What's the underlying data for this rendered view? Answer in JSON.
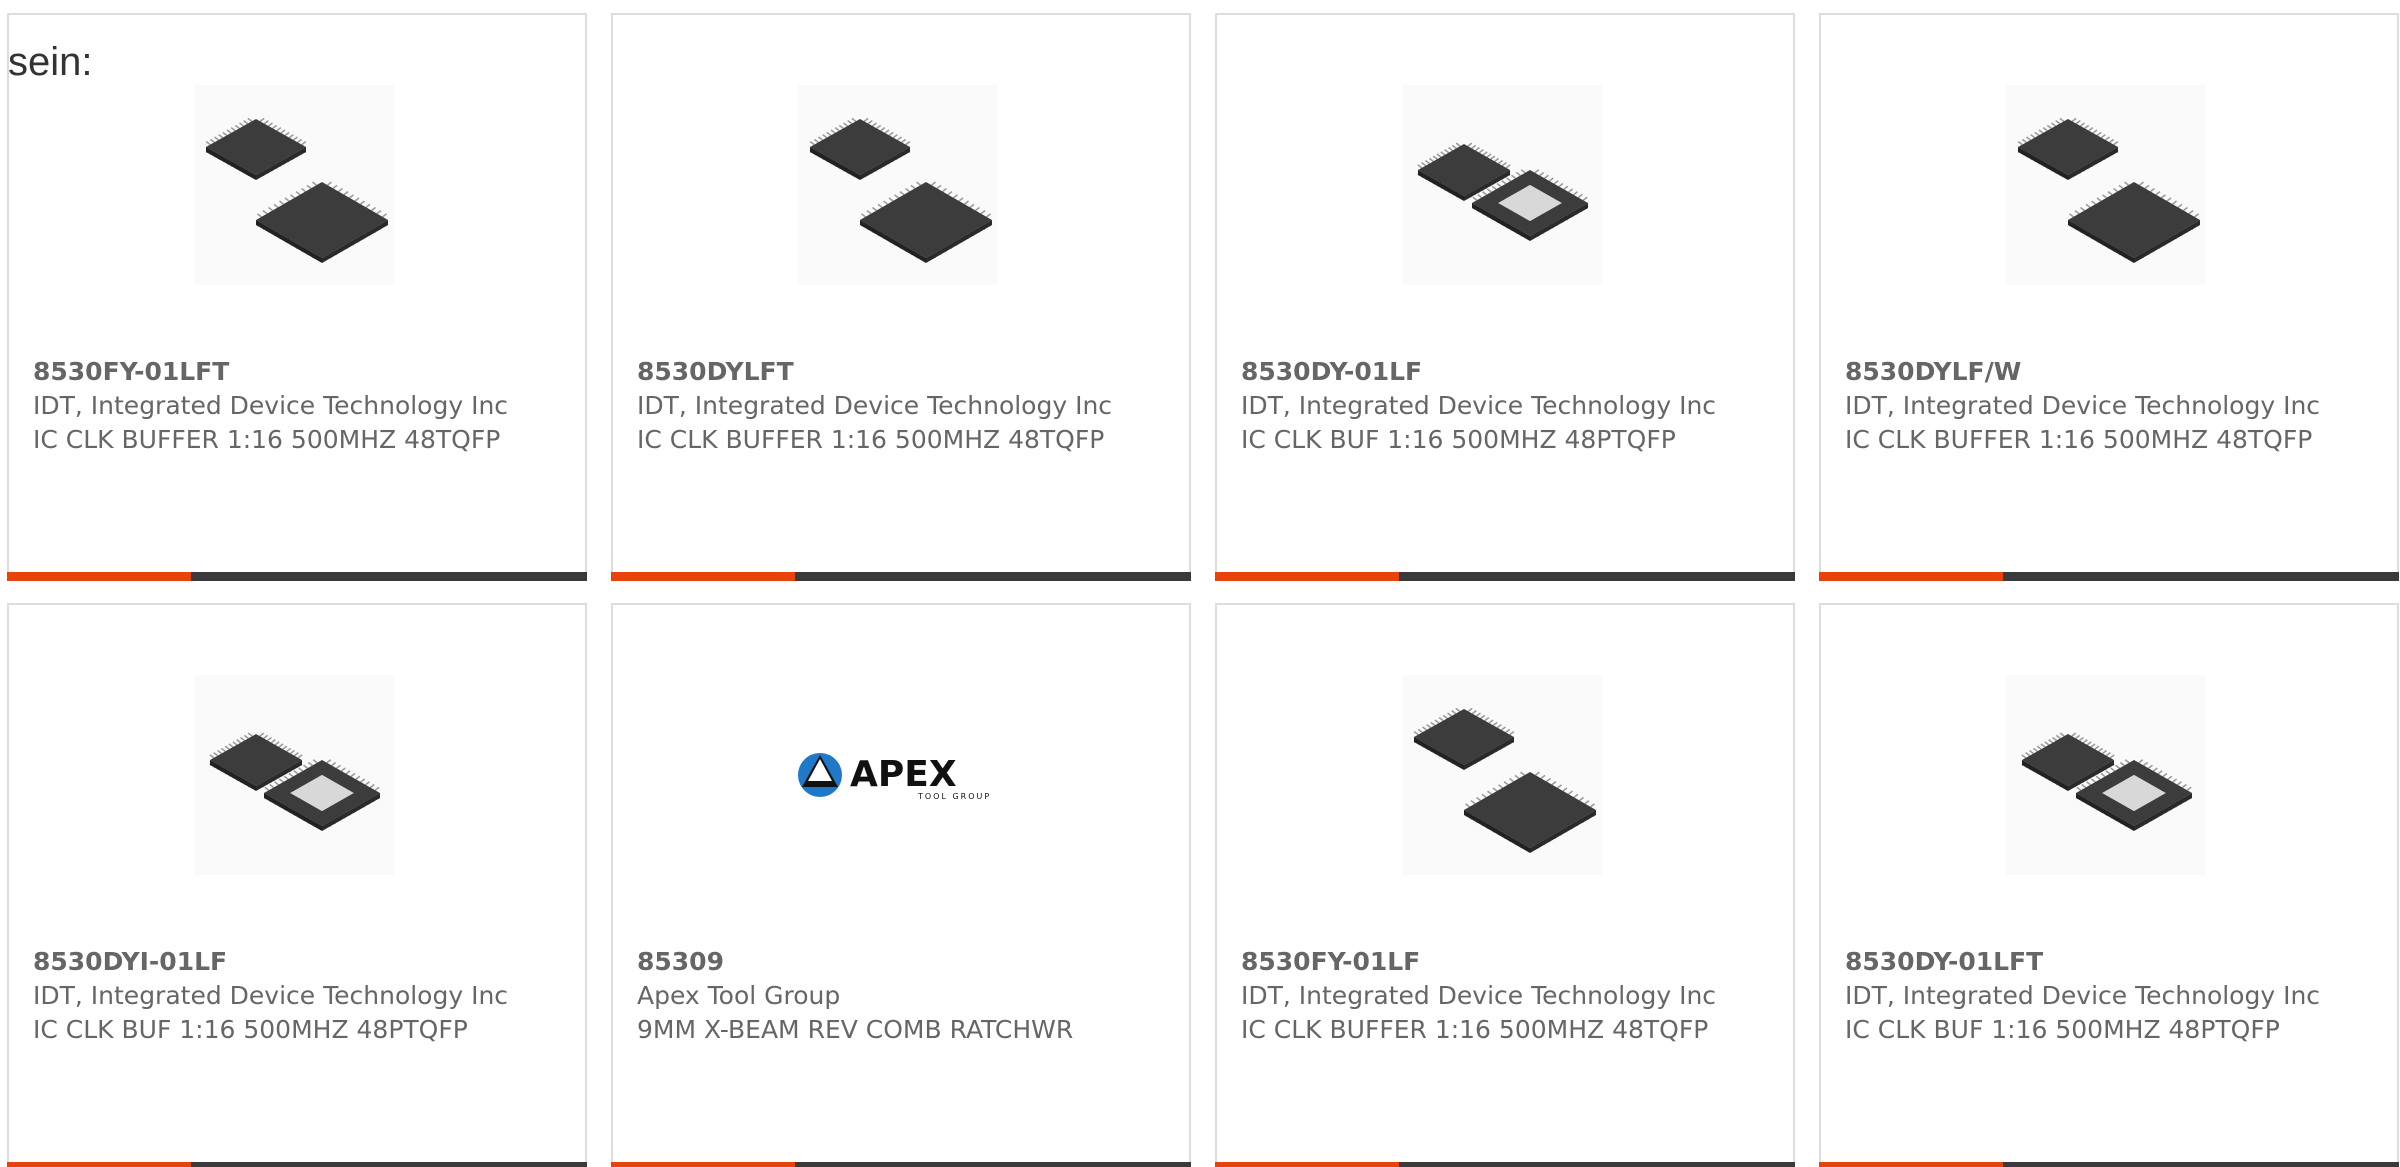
{
  "stray_text": "sein:",
  "colors": {
    "accent": "#e8430c",
    "bar": "#3a3a3a",
    "border": "#dddddd",
    "text": "#666666"
  },
  "products": [
    {
      "part": "8530FY-01LFT",
      "manufacturer": "IDT, Integrated Device Technology Inc",
      "description": "IC CLK BUFFER 1:16 500MHZ 48TQFP",
      "image": "chip-pair-dark"
    },
    {
      "part": "8530DYLFT",
      "manufacturer": "IDT, Integrated Device Technology Inc",
      "description": "IC CLK BUFFER 1:16 500MHZ 48TQFP",
      "image": "chip-pair-dark"
    },
    {
      "part": "8530DY-01LF",
      "manufacturer": "IDT, Integrated Device Technology Inc",
      "description": "IC CLK BUF 1:16 500MHZ 48PTQFP",
      "image": "chip-pair-exposed-pad"
    },
    {
      "part": "8530DYLF/W",
      "manufacturer": "IDT, Integrated Device Technology Inc",
      "description": "IC CLK BUFFER 1:16 500MHZ 48TQFP",
      "image": "chip-pair-dark"
    },
    {
      "part": "8530DYI-01LF",
      "manufacturer": "IDT, Integrated Device Technology Inc",
      "description": "IC CLK BUF 1:16 500MHZ 48PTQFP",
      "image": "chip-pair-exposed-pad"
    },
    {
      "part": "85309",
      "manufacturer": "Apex Tool Group",
      "description": "9MM X-BEAM REV COMB RATCHWR",
      "image": "apex-logo",
      "logo_text": "APEX",
      "logo_subtext": "TOOL GROUP"
    },
    {
      "part": "8530FY-01LF",
      "manufacturer": "IDT, Integrated Device Technology Inc",
      "description": "IC CLK BUFFER 1:16 500MHZ 48TQFP",
      "image": "chip-pair-dark"
    },
    {
      "part": "8530DY-01LFT",
      "manufacturer": "IDT, Integrated Device Technology Inc",
      "description": "IC CLK BUF 1:16 500MHZ 48PTQFP",
      "image": "chip-pair-exposed-pad"
    }
  ]
}
